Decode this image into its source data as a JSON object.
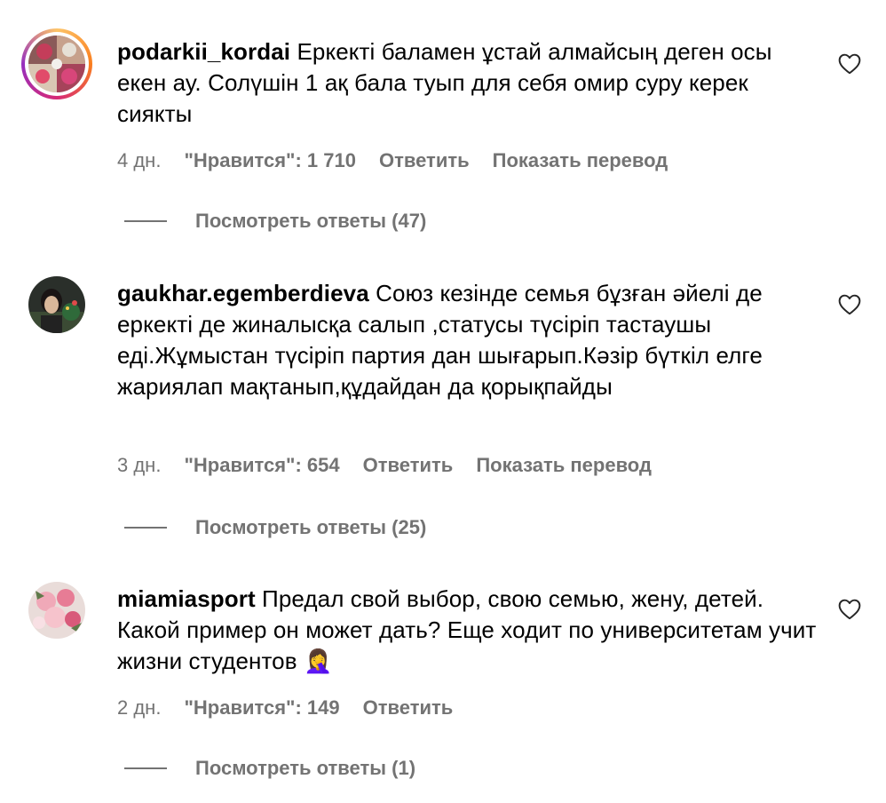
{
  "comments": [
    {
      "username": "podarkii_kordai",
      "text": "Еркекті баламен ұстай алмайсың деген осы екен ау. Солүшін 1 ақ бала туып для себя омир суру керек сиякты",
      "time": "4 дн.",
      "likes": "\"Нравится\": 1 710",
      "reply": "Ответить",
      "translate": "Показать перевод",
      "view_replies": "Посмотреть ответы (47)"
    },
    {
      "username": "gaukhar.egemberdieva",
      "text": "Союз кезінде семья бұзған әйелі де еркекті де жиналысқа салып ,статусы түсіріп тастаушы еді.Жұмыстан түсіріп партия дан шығарып.Кәзір бүткіл елге жариялап мақтанып,құдайдан да қорықпайды",
      "time": "3 дн.",
      "likes": "\"Нравится\": 654",
      "reply": "Ответить",
      "translate": "Показать перевод",
      "view_replies": "Посмотреть ответы (25)"
    },
    {
      "username": "miamiasport",
      "text": "Предал свой выбор, свою семью, жену, детей. Какой пример он может дать? Еще ходит по университетам учит жизни студентов 🤦‍♀️",
      "time": "2 дн.",
      "likes": "\"Нравится\": 149",
      "reply": "Ответить",
      "view_replies": "Посмотреть ответы (1)"
    }
  ],
  "icons": {
    "like": "heart-outline-icon",
    "story_ring": "story-ring"
  },
  "colors": {
    "secondary_text": "#737373",
    "primary_text": "#000000"
  }
}
